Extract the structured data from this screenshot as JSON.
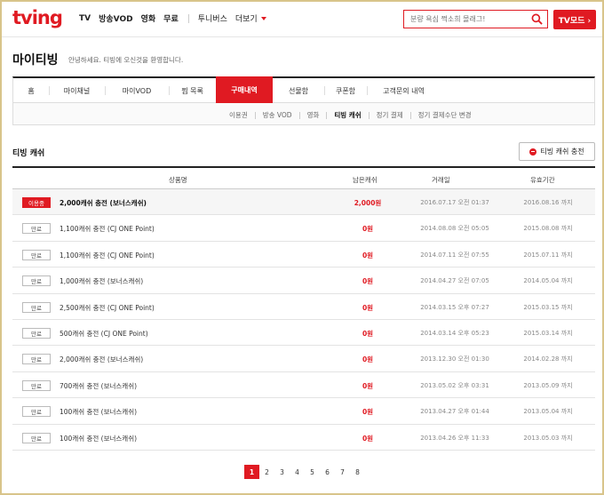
{
  "header": {
    "logo": "tving",
    "nav": [
      "TV",
      "방송VOD",
      "영화",
      "무료"
    ],
    "nav2": [
      "투니버스",
      "더보기"
    ],
    "search_placeholder": "분량 욕심 쩍소희 몰래그!",
    "tv_mode": "TV모드 ›"
  },
  "page": {
    "title": "마이티빙",
    "subtitle": "안녕하세요. 티빙에 오신것을 환영합니다."
  },
  "tabs": [
    "홈",
    "마이채널",
    "마이VOD",
    "찜 목록",
    "구매내역",
    "선물함",
    "쿠폰함",
    "고객문의 내역"
  ],
  "active_tab": "구매내역",
  "subtabs": [
    "이용권",
    "방송 VOD",
    "영화",
    "티빙 캐쉬",
    "정기 결제",
    "정기 결제수단 변경"
  ],
  "active_subtab": "티빙 캐쉬",
  "section": {
    "title": "티빙 캐쉬",
    "charge_button": "티빙 캐쉬 충전"
  },
  "table": {
    "headers": [
      "상품명",
      "남은캐쉬",
      "거래일",
      "유효기간"
    ],
    "rows": [
      {
        "status": "이용중",
        "name": "2,000캐쉬 충전 (보너스캐쉬)",
        "remain": "2,000원",
        "date": "2016.07.17 오전 01:37",
        "expiry": "2016.08.16 까지"
      },
      {
        "status": "만료",
        "name": "1,100캐쉬 충전 (CJ ONE Point)",
        "remain": "0원",
        "date": "2014.08.08 오전 05:05",
        "expiry": "2015.08.08 까지"
      },
      {
        "status": "만료",
        "name": "1,100캐쉬 충전 (CJ ONE Point)",
        "remain": "0원",
        "date": "2014.07.11 오전 07:55",
        "expiry": "2015.07.11 까지"
      },
      {
        "status": "만료",
        "name": "1,000캐쉬 충전 (보너스캐쉬)",
        "remain": "0원",
        "date": "2014.04.27 오전 07:05",
        "expiry": "2014.05.04 까지"
      },
      {
        "status": "만료",
        "name": "2,500캐쉬 충전 (CJ ONE Point)",
        "remain": "0원",
        "date": "2014.03.15 오후 07:27",
        "expiry": "2015.03.15 까지"
      },
      {
        "status": "만료",
        "name": "500캐쉬 충전 (CJ ONE Point)",
        "remain": "0원",
        "date": "2014.03.14 오후 05:23",
        "expiry": "2015.03.14 까지"
      },
      {
        "status": "만료",
        "name": "2,000캐쉬 충전 (보너스캐쉬)",
        "remain": "0원",
        "date": "2013.12.30 오전 01:30",
        "expiry": "2014.02.28 까지"
      },
      {
        "status": "만료",
        "name": "700캐쉬 충전 (보너스캐쉬)",
        "remain": "0원",
        "date": "2013.05.02 오후 03:31",
        "expiry": "2013.05.09 까지"
      },
      {
        "status": "만료",
        "name": "100캐쉬 충전 (보너스캐쉬)",
        "remain": "0원",
        "date": "2013.04.27 오후 01:44",
        "expiry": "2013.05.04 까지"
      },
      {
        "status": "만료",
        "name": "100캐쉬 충전 (보너스캐쉬)",
        "remain": "0원",
        "date": "2013.04.26 오후 11:33",
        "expiry": "2013.05.03 까지"
      }
    ]
  },
  "pagination": {
    "pages": [
      "1",
      "2",
      "3",
      "4",
      "5",
      "6",
      "7",
      "8"
    ],
    "current": "1"
  },
  "colors": {
    "brand": "#e01a22",
    "frame": "#d8c48a"
  }
}
